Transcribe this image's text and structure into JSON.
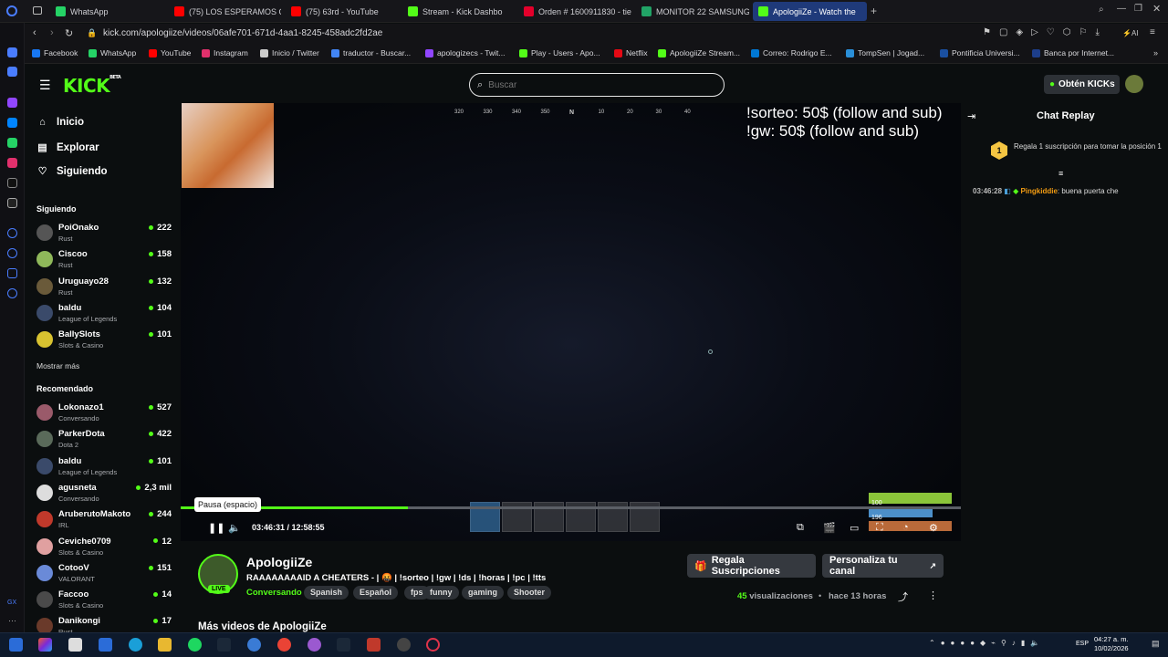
{
  "browser": {
    "tabs": [
      {
        "label": "WhatsApp",
        "color": "#25d366"
      },
      {
        "label": "(75) LOS ESPERAMOS QU",
        "color": "#ff0000"
      },
      {
        "label": "(75) 63rd - YouTube",
        "color": "#ff0000"
      },
      {
        "label": "Stream - Kick Dashbo",
        "color": "#53fc18"
      },
      {
        "label": "Orden # 1600911830 - tie",
        "color": "#e4002b"
      },
      {
        "label": "MONITOR 22 SAMSUNG",
        "color": "#21a366"
      },
      {
        "label": "ApologiiZe - Watch the",
        "color": "#53fc18"
      }
    ],
    "url": "kick.com/apologiize/videos/06afe701-671d-4aa1-8245-458adc2fd2ae",
    "bookmarks": [
      {
        "label": "Facebook",
        "color": "#1877f2"
      },
      {
        "label": "WhatsApp",
        "color": "#25d366"
      },
      {
        "label": "YouTube",
        "color": "#ff0000"
      },
      {
        "label": "Instagram",
        "color": "#e1306c"
      },
      {
        "label": "Inicio / Twitter",
        "color": "#cccccc"
      },
      {
        "label": "traductor - Buscar...",
        "color": "#4285f4"
      },
      {
        "label": "apologizecs - Twit...",
        "color": "#9146ff"
      },
      {
        "label": "Play - Users - Apo...",
        "color": "#53fc18"
      },
      {
        "label": "Netflix",
        "color": "#e50914"
      },
      {
        "label": "ApologiiZe Stream...",
        "color": "#53fc18"
      },
      {
        "label": "Correo: Rodrigo E...",
        "color": "#0078d4"
      },
      {
        "label": "TompSen | Jogad...",
        "color": "#2a8fd8"
      },
      {
        "label": "Pontificia Universi...",
        "color": "#1a4fa0"
      },
      {
        "label": "Banca por Internet...",
        "color": "#1d3e8a"
      }
    ]
  },
  "header": {
    "logo": "KICK",
    "logo_sup": "BETA",
    "search_placeholder": "Buscar",
    "kicks_button": "Obtén KICKs"
  },
  "nav": {
    "items": [
      {
        "label": "Inicio",
        "icon": "home-icon",
        "glyph": "⌂"
      },
      {
        "label": "Explorar",
        "icon": "browse-icon",
        "glyph": "▤"
      },
      {
        "label": "Siguiendo",
        "icon": "heart-icon",
        "glyph": "♡"
      }
    ],
    "following_title": "Siguiendo",
    "following": [
      {
        "name": "PoiOnako",
        "category": "Rust",
        "viewers": "222",
        "color": "#555"
      },
      {
        "name": "Ciscoo",
        "category": "Rust",
        "viewers": "158",
        "color": "#8fb85a"
      },
      {
        "name": "Uruguayo28",
        "category": "Rust",
        "viewers": "132",
        "color": "#6a5a3a"
      },
      {
        "name": "baldu",
        "category": "League of Legends",
        "viewers": "104",
        "color": "#3a4a6a"
      },
      {
        "name": "BallySlots",
        "category": "Slots & Casino",
        "viewers": "101",
        "color": "#d8c230"
      }
    ],
    "show_more": "Mostrar más",
    "recommended_title": "Recomendado",
    "recommended": [
      {
        "name": "Lokonazo1",
        "category": "Conversando",
        "viewers": "527",
        "color": "#9a5a6a"
      },
      {
        "name": "ParkerDota",
        "category": "Dota 2",
        "viewers": "422",
        "color": "#5a6a5a"
      },
      {
        "name": "baldu",
        "category": "League of Legends",
        "viewers": "101",
        "color": "#3a4a6a"
      },
      {
        "name": "agusneta",
        "category": "Conversando",
        "viewers": "2,3 mil",
        "color": "#dddddd"
      },
      {
        "name": "AruberutoMakoto",
        "category": "IRL",
        "viewers": "244",
        "color": "#c0392b"
      },
      {
        "name": "Ceviche0709",
        "category": "Slots & Casino",
        "viewers": "12",
        "color": "#e0a0a0"
      },
      {
        "name": "CotooV",
        "category": "VALORANT",
        "viewers": "151",
        "color": "#6a8ad8"
      },
      {
        "name": "Faccoo",
        "category": "Slots & Casino",
        "viewers": "14",
        "color": "#4a4a4a"
      },
      {
        "name": "Danikongi",
        "category": "Rust",
        "viewers": "17",
        "color": "#6a3a2a"
      }
    ]
  },
  "video": {
    "overlay_line1": "!sorteo: 50$ (follow and sub)",
    "overlay_line2": "!gw: 50$ (follow and sub)",
    "compass": [
      "320",
      "330",
      "340",
      "350",
      "N",
      "10",
      "20",
      "30",
      "40"
    ],
    "tooltip": "Pausa (espacio)",
    "time": "03:46:31 / 12:58:55",
    "progress": 0.291,
    "hud_health": "100",
    "hud_food": "196"
  },
  "chat": {
    "title": "Chat Replay",
    "gift_rank": "1",
    "gift_text": "Regala 1 suscripción para tomar la posición 1",
    "message": {
      "time": "03:46:28",
      "user": "Pingkiddie",
      "user_color": "#f39c12",
      "text": "buena puerta che"
    }
  },
  "channel": {
    "name": "ApologiiZe",
    "live_badge": "LIVE",
    "title": "RAAAAAAAAID A CHEATERS - | 🤬 | !sorteo | !gw | !ds | !horas | !pc | !tts",
    "category": "Conversando",
    "tags": [
      "Spanish",
      "Español",
      "fps",
      "funny",
      "gaming",
      "Shooter"
    ],
    "gift_button": "Regala Suscripciones",
    "customize_button": "Personaliza tu canal",
    "views_count": "45",
    "views_label": "visualizaciones",
    "time_ago": "hace 13 horas",
    "more_videos": "Más videos de ApologiiZe"
  },
  "taskbar": {
    "lang": "ESP",
    "time": "04:27 a. m.",
    "date": "10/02/2026"
  }
}
